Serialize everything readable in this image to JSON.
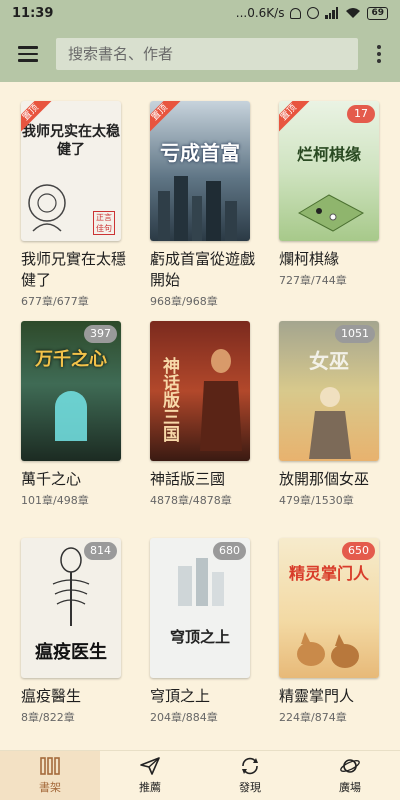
{
  "status_bar": {
    "time": "11:39",
    "network_speed": "...0.6K/s",
    "battery": "69"
  },
  "app_bar": {
    "menu_icon": "hamburger-menu-icon",
    "search_placeholder": "搜索書名、作者",
    "more_icon": "more-vertical-icon"
  },
  "books": [
    {
      "title": "我师兄實在太穩健了",
      "chapters": "677章/677章",
      "top_badge": "置顶",
      "count": "",
      "cover_text": "我师兄实在太稳健了"
    },
    {
      "title": "虧成首富從遊戲開始",
      "chapters": "968章/968章",
      "top_badge": "置顶",
      "count": "",
      "cover_text": "亏成首富"
    },
    {
      "title": "爛柯棋緣",
      "chapters": "727章/744章",
      "top_badge": "置顶",
      "count": "17",
      "cover_text": "烂柯棋缘"
    },
    {
      "title": "萬千之心",
      "chapters": "101章/498章",
      "top_badge": "",
      "count": "397",
      "cover_text": "万千之心"
    },
    {
      "title": "神話版三國",
      "chapters": "4878章/4878章",
      "top_badge": "",
      "count": "",
      "cover_text": "神话版三国"
    },
    {
      "title": "放開那個女巫",
      "chapters": "479章/1530章",
      "top_badge": "",
      "count": "1051",
      "cover_text": "女巫"
    },
    {
      "title": "瘟疫醫生",
      "chapters": "8章/822章",
      "top_badge": "",
      "count": "814",
      "cover_text": "瘟疫医生"
    },
    {
      "title": "穹頂之上",
      "chapters": "204章/884章",
      "top_badge": "",
      "count": "680",
      "cover_text": "穹顶之上"
    },
    {
      "title": "精靈掌門人",
      "chapters": "224章/874章",
      "top_badge": "",
      "count": "650",
      "cover_text": "精灵掌门人"
    }
  ],
  "bottom_nav": [
    {
      "label": "書架",
      "icon": "bookshelf-icon",
      "active": true
    },
    {
      "label": "推薦",
      "icon": "paper-plane-icon",
      "active": false
    },
    {
      "label": "發現",
      "icon": "discover-refresh-icon",
      "active": false
    },
    {
      "label": "廣場",
      "icon": "planet-icon",
      "active": false
    }
  ],
  "colors": {
    "app_bar": "#b6c6a6",
    "background": "#fbf2dd",
    "badge_red": "#e45b4c",
    "nav_active": "#a56a3c"
  }
}
